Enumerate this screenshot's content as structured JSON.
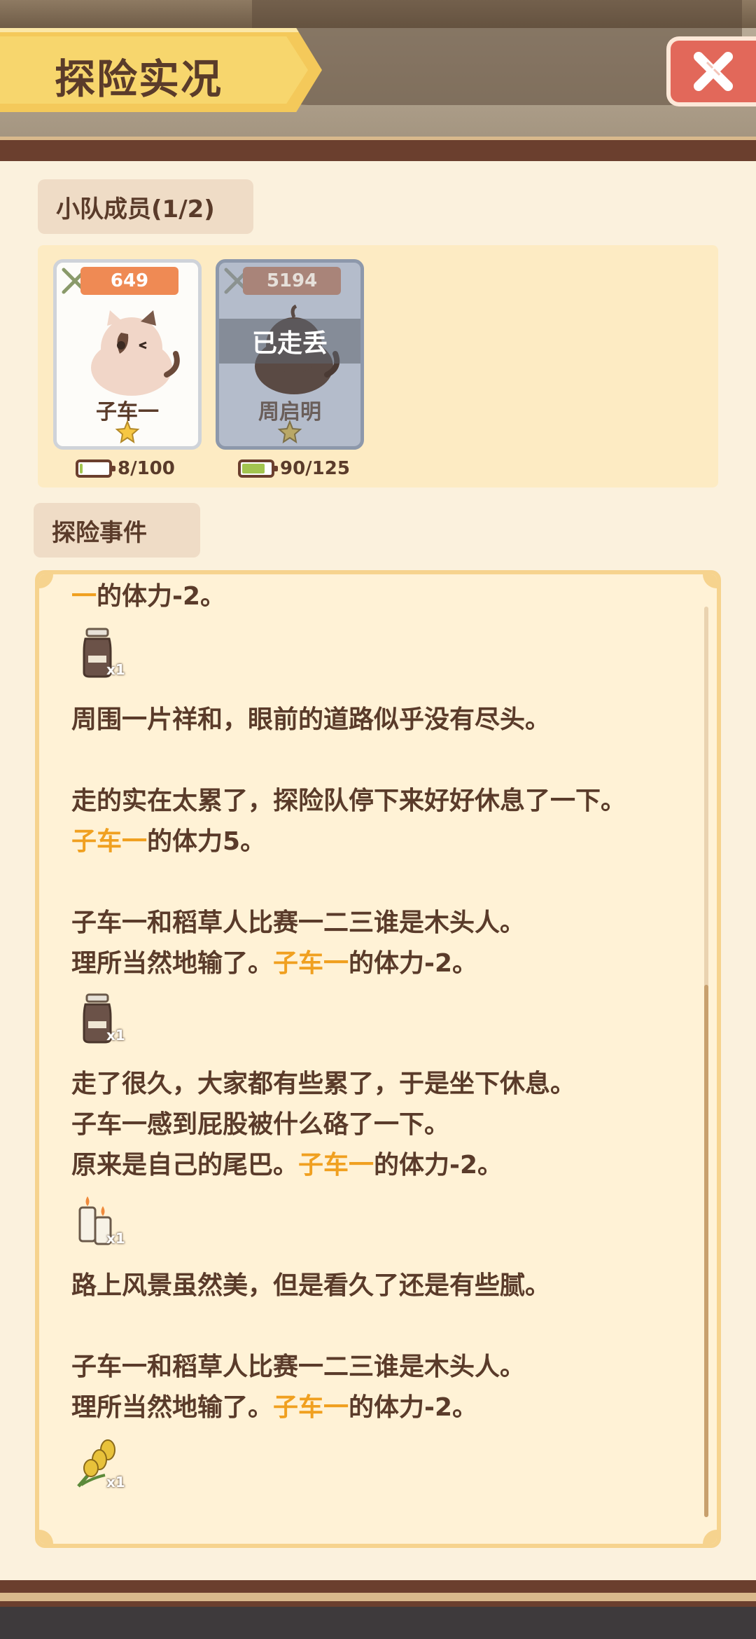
{
  "header": {
    "title": "探险实况",
    "close_icon": "close-icon"
  },
  "team": {
    "label": "小队成员(1/2)",
    "members": [
      {
        "name": "子车一",
        "power": "649",
        "stamina": "8/100",
        "stamina_fraction": 0.08,
        "stars": 1,
        "status": ""
      },
      {
        "name": "周启明",
        "power": "5194",
        "stamina": "90/125",
        "stamina_fraction": 0.72,
        "stars": 1,
        "status": "已走丢"
      }
    ]
  },
  "events": {
    "label": "探险事件",
    "lines": [
      {
        "pre": "",
        "hl": "一",
        "post": "的体力-2。"
      },
      {
        "pre": "周围一片祥和，眼前的道路似乎没有尽头。",
        "hl": "",
        "post": ""
      },
      {
        "pre": "走的实在太累了，探险队停下来好好休息了一下。",
        "hl": "",
        "post": ""
      },
      {
        "pre": "",
        "hl": "子车一",
        "post": "的体力5。"
      },
      {
        "pre": "子车一和稻草人比赛一二三谁是木头人。",
        "hl": "",
        "post": ""
      },
      {
        "pre": "理所当然地输了。",
        "hl": "子车一",
        "post": "的体力-2。"
      },
      {
        "pre": "走了很久，大家都有些累了，于是坐下休息。",
        "hl": "",
        "post": ""
      },
      {
        "pre": "子车一感到屁股被什么硌了一下。",
        "hl": "",
        "post": ""
      },
      {
        "pre": "原来是自己的尾巴。",
        "hl": "子车一",
        "post": "的体力-2。"
      },
      {
        "pre": "路上风景虽然美，但是看久了还是有些腻。",
        "hl": "",
        "post": ""
      },
      {
        "pre": "子车一和稻草人比赛一二三谁是木头人。",
        "hl": "",
        "post": ""
      },
      {
        "pre": "理所当然地输了。",
        "hl": "子车一",
        "post": "的体力-2。"
      }
    ],
    "items": [
      {
        "icon": "milk-bottle-icon",
        "qty": "x1"
      },
      {
        "icon": "milk-bottle-icon",
        "qty": "x1"
      },
      {
        "icon": "candles-icon",
        "qty": "x1"
      },
      {
        "icon": "wheat-icon",
        "qty": "x1"
      }
    ]
  },
  "colors": {
    "highlight": "#f0a020",
    "text": "#5a3b2a",
    "ribbon": "#f7d66d",
    "close": "#e2685a"
  }
}
